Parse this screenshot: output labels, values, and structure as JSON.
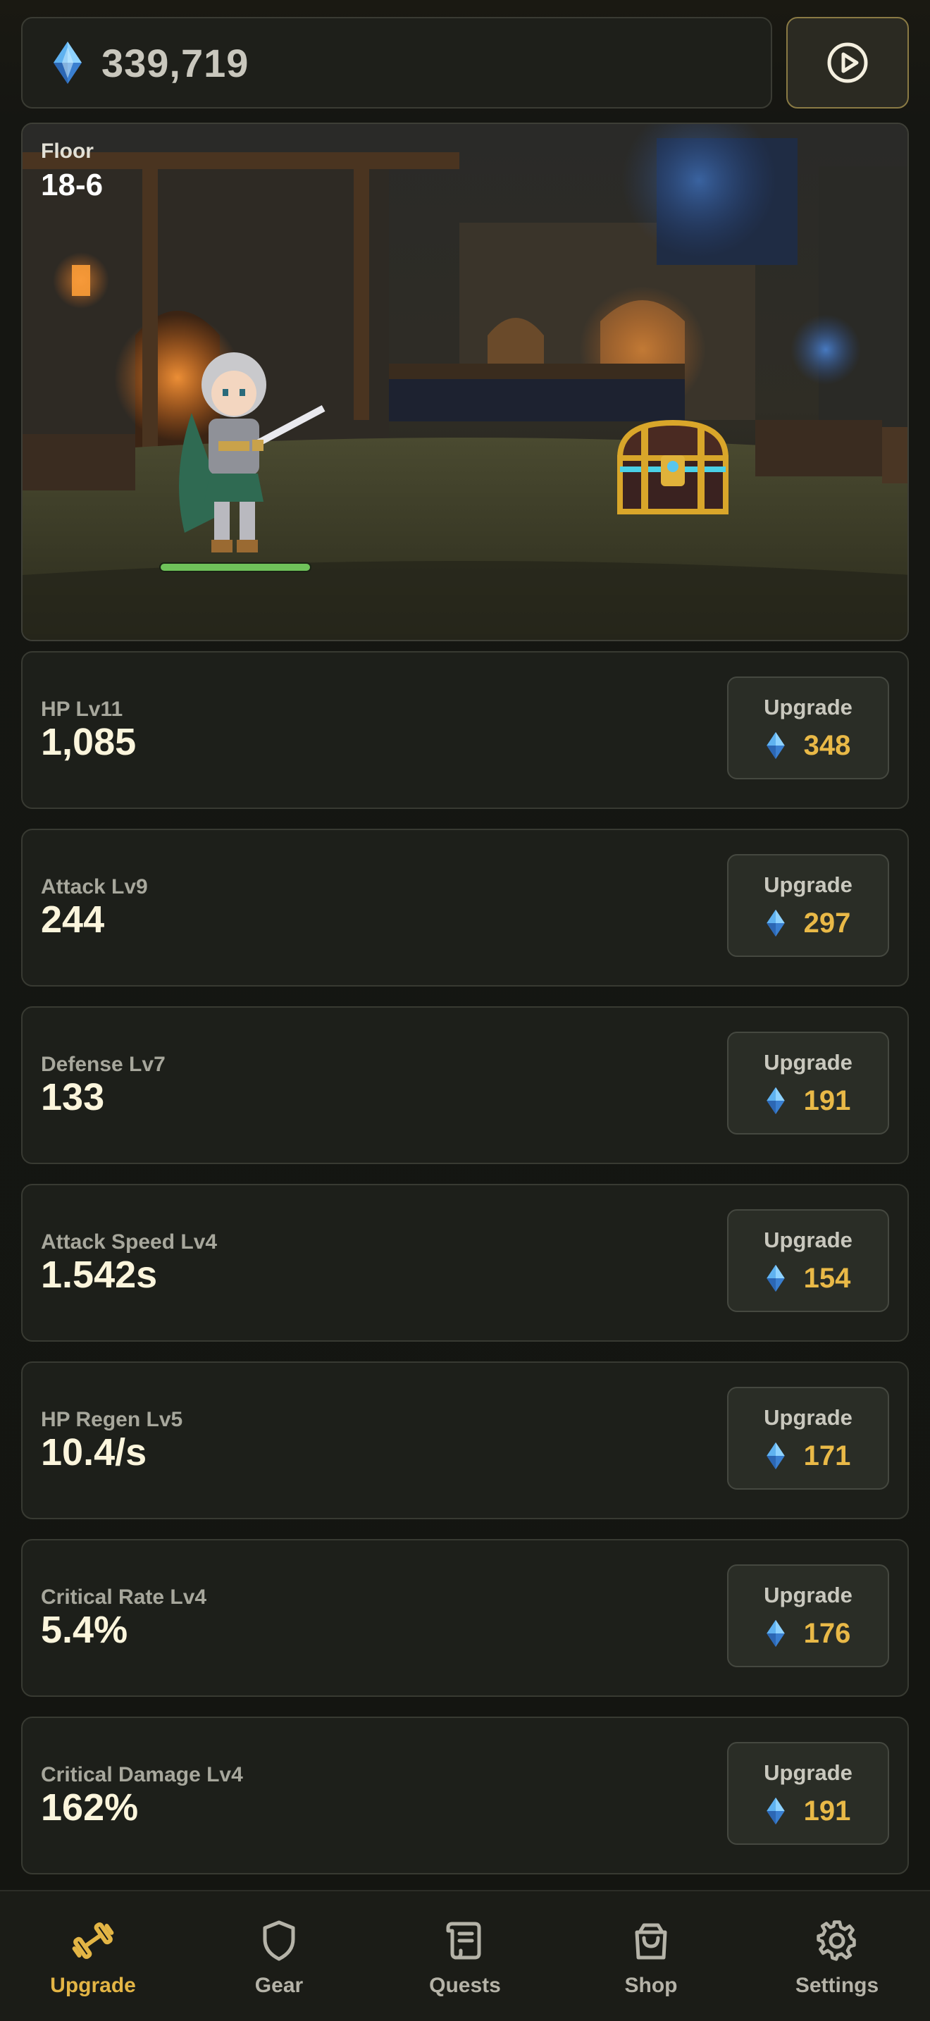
{
  "header": {
    "currency_icon": "gem-icon",
    "currency_amount": "339,719",
    "play_icon": "play-circle-icon"
  },
  "scene": {
    "floor_label": "Floor",
    "floor_value": "18-6",
    "hero_hp_fraction": 1.0
  },
  "upgrades": [
    {
      "name": "HP Lv11",
      "value": "1,085",
      "button": "Upgrade",
      "cost": "348"
    },
    {
      "name": "Attack Lv9",
      "value": "244",
      "button": "Upgrade",
      "cost": "297"
    },
    {
      "name": "Defense Lv7",
      "value": "133",
      "button": "Upgrade",
      "cost": "191"
    },
    {
      "name": "Attack Speed Lv4",
      "value": "1.542s",
      "button": "Upgrade",
      "cost": "154"
    },
    {
      "name": "HP Regen Lv5",
      "value": "10.4/s",
      "button": "Upgrade",
      "cost": "171"
    },
    {
      "name": "Critical Rate Lv4",
      "value": "5.4%",
      "button": "Upgrade",
      "cost": "176"
    },
    {
      "name": "Critical Damage Lv4",
      "value": "162%",
      "button": "Upgrade",
      "cost": "191"
    }
  ],
  "nav": {
    "items": [
      {
        "label": "Upgrade",
        "icon": "dumbbell-icon",
        "active": true
      },
      {
        "label": "Gear",
        "icon": "shield-icon",
        "active": false
      },
      {
        "label": "Quests",
        "icon": "scroll-icon",
        "active": false
      },
      {
        "label": "Shop",
        "icon": "shopping-bag-icon",
        "active": false
      },
      {
        "label": "Settings",
        "icon": "gear-icon",
        "active": false
      }
    ]
  },
  "colors": {
    "accent_gold": "#e3b545",
    "cost_gold": "#e9b947",
    "gem_blue": "#5fb2f0",
    "hp_green": "#6fc25a"
  }
}
